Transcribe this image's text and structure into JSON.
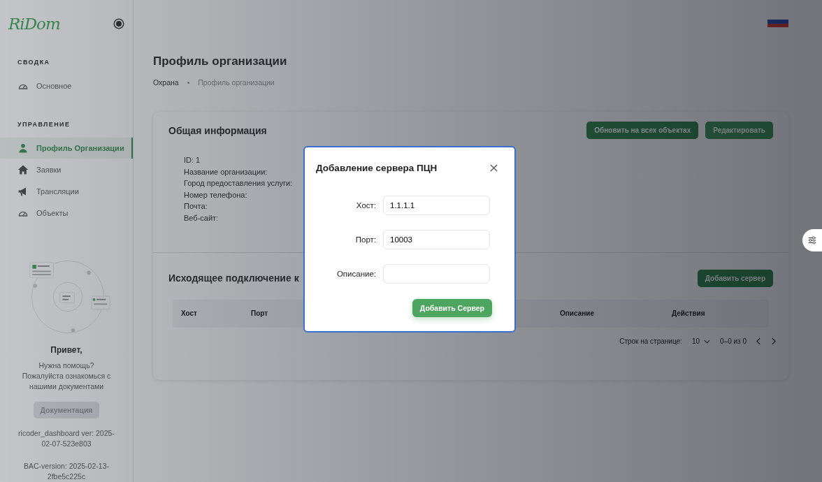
{
  "sidebar": {
    "logo": "RiDom",
    "sections": [
      {
        "title": "СВОДКА",
        "items": [
          {
            "label": "Основное",
            "selected": false
          }
        ]
      },
      {
        "title": "УПРАВЛЕНИЕ",
        "items": [
          {
            "label": "Профиль Организации",
            "selected": true
          },
          {
            "label": "Заявки",
            "selected": false
          },
          {
            "label": "Трансляции",
            "selected": false
          },
          {
            "label": "Объекты",
            "selected": false
          }
        ]
      }
    ],
    "help": {
      "title": "Привет,",
      "text": "Нужна помощь? Пожалуйста ознакомься с нашими документами",
      "button": "Документация"
    },
    "versions": [
      "ricoder_dashboard ver: 2025-02-07-523e803",
      "BAC-version: 2025-02-13-2fbe5c225c"
    ]
  },
  "page": {
    "title": "Профиль организации",
    "breadcrumbs": [
      "Охрана",
      "Профиль организации"
    ],
    "breadcrumb_separator": "•"
  },
  "info_card": {
    "title": "Общая информация",
    "buttons": [
      "Обновить на всех объектах",
      "Редактировать"
    ],
    "fields": [
      "ID: 1",
      "Название организации:",
      "Город предоставления услуги:",
      "Номер телефона:",
      "Почта:",
      "Веб-сайт:"
    ]
  },
  "servers_card": {
    "title": "Исходящее подключение к",
    "button": "Добавить сервер",
    "columns": [
      "Хост",
      "Порт",
      "Описание",
      "Действия"
    ],
    "pagination": {
      "rows_label": "Строк на странице:",
      "rows_value": "10",
      "range": "0–0 из 0"
    }
  },
  "modal": {
    "title": "Добавление сервера ПЦН",
    "fields": [
      {
        "label": "Хост:",
        "value": "1.1.1.1"
      },
      {
        "label": "Порт:",
        "value": "10003"
      },
      {
        "label": "Описание:"
      }
    ],
    "submit": "Добавить Сервер"
  }
}
